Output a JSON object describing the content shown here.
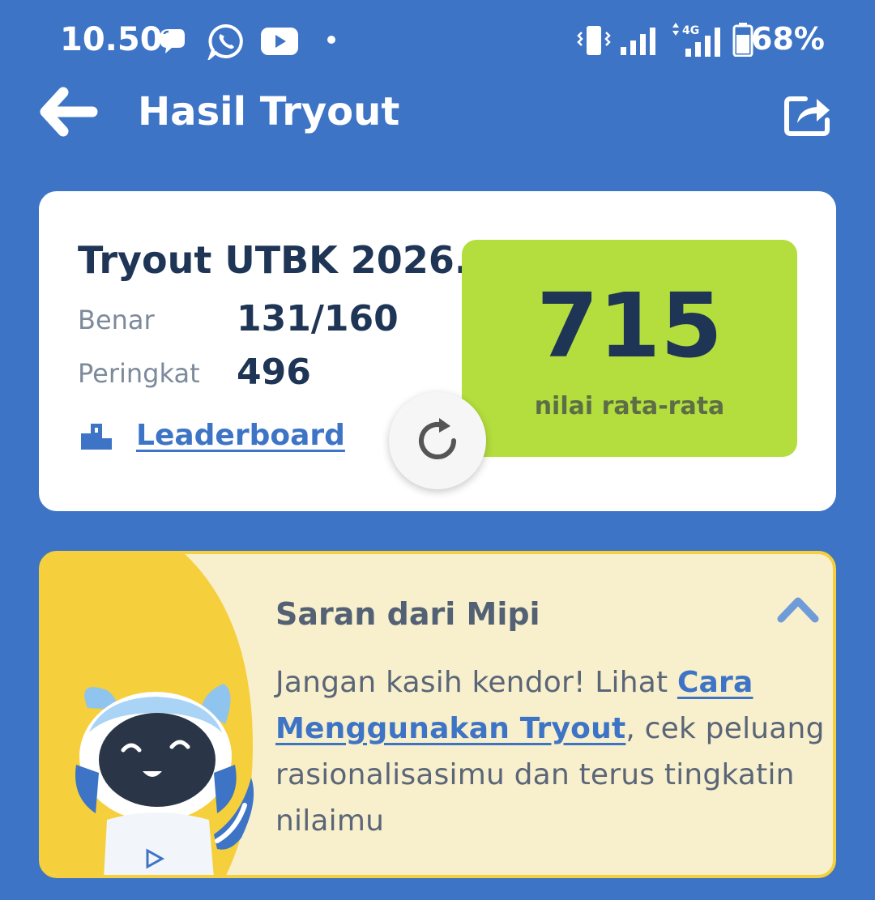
{
  "status_bar": {
    "time": "10.50",
    "battery_percent": "68%",
    "notification_icons": [
      "chat-bubble-icon",
      "whatsapp-icon",
      "youtube-icon",
      "dot-icon"
    ],
    "system_icons": [
      "vibrate-icon",
      "signal-icon",
      "4g-signal-icon",
      "battery-icon"
    ],
    "network_label": "4G"
  },
  "app_bar": {
    "title": "Hasil Tryout",
    "back_icon": "back-arrow-icon",
    "share_icon": "share-icon"
  },
  "result": {
    "tryout_name": "Tryout UTBK 2026...",
    "correct_label": "Benar",
    "correct_value": "131/160",
    "rank_label": "Peringkat",
    "rank_value": "496",
    "leaderboard_label": "Leaderboard",
    "score_value": "715",
    "score_label": "nilai rata-rata"
  },
  "saran": {
    "title": "Saran dari Mipi",
    "body_prefix": "Jangan kasih kendor! Lihat ",
    "body_link": "Cara Menggunakan Tryout",
    "body_suffix": ", cek peluang rasionalisasimu dan terus tingkatin nilaimu"
  },
  "colors": {
    "background": "#3d74c6",
    "card": "#ffffff",
    "score_box": "#b4de3e",
    "navy_text": "#1f3555",
    "saran_bg": "#f8efcc",
    "saran_accent": "#f5cf3c"
  }
}
